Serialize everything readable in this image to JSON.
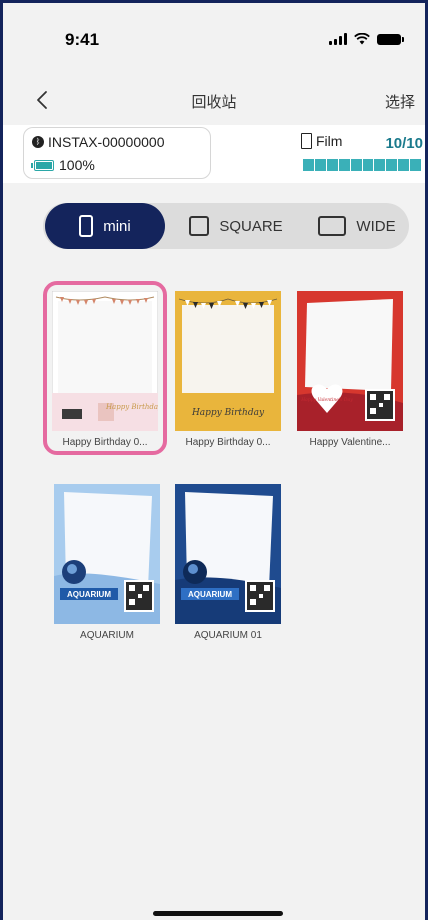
{
  "status_bar": {
    "time": "9:41"
  },
  "nav": {
    "title": "回收站",
    "select_label": "选择"
  },
  "printer": {
    "name": "INSTAX-00000000",
    "battery": "100%"
  },
  "film": {
    "label": "Film",
    "count": "10/10",
    "level": 1.0
  },
  "tabs": [
    {
      "label": "mini",
      "active": true
    },
    {
      "label": "SQUARE",
      "active": false
    },
    {
      "label": "WIDE",
      "active": false
    }
  ],
  "frames": [
    {
      "caption": "Happy Birthday 0...",
      "selected": true
    },
    {
      "caption": "Happy Birthday 0...",
      "selected": false
    },
    {
      "caption": "Happy Valentine...",
      "selected": false
    },
    {
      "caption": "AQUARIUM",
      "selected": false
    },
    {
      "caption": "AQUARIUM 01",
      "selected": false
    }
  ],
  "frame_art": {
    "birthday_1_script": "Happy Birthday",
    "birthday_2_script": "Happy Birthday",
    "valentine_text": "Happy Valentine's Day",
    "aquarium_text": "AQUARIUM"
  },
  "colors": {
    "accent_navy": "#14245c",
    "selection_pink": "#e56aa0",
    "film_teal": "#3ab0b8"
  },
  "icons": [
    "back-chevron-icon",
    "bluetooth-icon",
    "battery-icon",
    "film-icon",
    "signal-icon",
    "wifi-icon"
  ]
}
